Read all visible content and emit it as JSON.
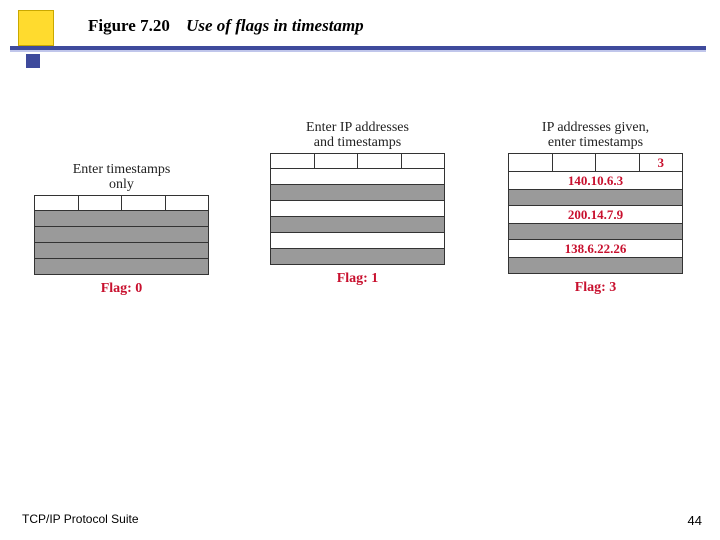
{
  "title": {
    "figure_number": "Figure 7.20",
    "caption": "Use of flags in timestamp"
  },
  "columns": [
    {
      "heading_line1": "Enter timestamps",
      "heading_line2": "only",
      "header_flag_value": "",
      "rows": [
        "",
        "",
        "",
        ""
      ],
      "flag_label": "Flag: 0"
    },
    {
      "heading_line1": "Enter IP addresses",
      "heading_line2": "and timestamps",
      "header_flag_value": "",
      "rows": [
        "",
        "",
        "",
        "",
        "",
        ""
      ],
      "flag_label": "Flag: 1"
    },
    {
      "heading_line1": "IP addresses given,",
      "heading_line2": "enter timestamps",
      "header_flag_value": "3",
      "rows": [
        "140.10.6.3",
        "",
        "200.14.7.9",
        "",
        "138.6.22.26",
        ""
      ],
      "flag_label": "Flag: 3"
    }
  ],
  "footer": {
    "left": "TCP/IP Protocol Suite",
    "page": "44"
  }
}
